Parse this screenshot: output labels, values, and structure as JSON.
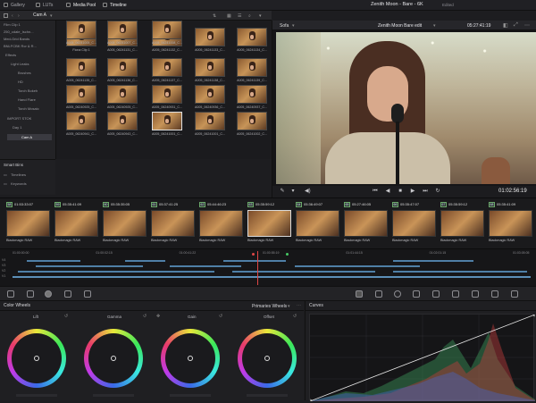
{
  "tabs": [
    {
      "label": "Gallery"
    },
    {
      "label": "LUTs"
    },
    {
      "label": "Media Pool"
    },
    {
      "label": "Timeline"
    }
  ],
  "project": {
    "title": "Zenith Moon - Bare - 6K",
    "status": "Edited"
  },
  "media_toolbar": {
    "bin": "Cam A"
  },
  "viewer": {
    "timeline_name": "Zenith Moon Bare edit",
    "timecode": "05:27:41:19",
    "clip_name": "Sofa",
    "zoom": "65%",
    "playhead_tc": "01:02:56:19"
  },
  "tree": [
    {
      "label": "Film Clip 1"
    },
    {
      "label": "250_cdale_Ischn..."
    },
    {
      "label": "Med-Grid Bands"
    },
    {
      "label": "BNLFCBK Rcr & R..."
    },
    {
      "label": "Effects"
    },
    {
      "label": "Light Leaks"
    },
    {
      "label": "Brushes"
    },
    {
      "label": "HD"
    },
    {
      "label": "Torch Bokeh"
    },
    {
      "label": "Hand Flare"
    },
    {
      "label": "Torch Mosaic"
    },
    {
      "label": "IMPORT STOK"
    },
    {
      "label": "Day 1"
    },
    {
      "label": "Cam A"
    }
  ],
  "smart_bins": {
    "title": "Smart Bins",
    "items": [
      {
        "label": "Timelines"
      },
      {
        "label": "Keywords"
      }
    ]
  },
  "media_clips": [
    {
      "label": "Fiona Clip 1"
    },
    {
      "label": "A005_06241131_C..."
    },
    {
      "label": "A005_06241132_C..."
    },
    {
      "label": "A005_06241133_C..."
    },
    {
      "label": "A005_06241134_C..."
    },
    {
      "label": "A005_06241135_C..."
    },
    {
      "label": "A005_06241136_C..."
    },
    {
      "label": "A005_06241137_C..."
    },
    {
      "label": "A005_06241138_C..."
    },
    {
      "label": "A005_06241139_C..."
    },
    {
      "label": "A005_06240925_C..."
    },
    {
      "label": "A005_06240925_C..."
    },
    {
      "label": "A005_06240931_C..."
    },
    {
      "label": "A005_06240936_C..."
    },
    {
      "label": "A005_06240937_C..."
    },
    {
      "label": "A005_06240941_C..."
    },
    {
      "label": "A005_06240943_C..."
    },
    {
      "label": "A005_06241001_C..."
    },
    {
      "label": "A005_06241001_C..."
    },
    {
      "label": "A005_06241002_C..."
    },
    {
      "label": "A005_06241005_C..."
    },
    {
      "label": "A005_06241007_C..."
    },
    {
      "label": "A005_06241008_C..."
    }
  ],
  "strip_clips": [
    {
      "num": "58",
      "tc": "01:53:33:07",
      "label": "Blackmagic RAW"
    },
    {
      "num": "59",
      "tc": "05:35:41:09",
      "label": "Blackmagic RAW"
    },
    {
      "num": "60",
      "tc": "05:35:35:05",
      "label": "Blackmagic RAW"
    },
    {
      "num": "61",
      "tc": "05:37:41:25",
      "label": "Blackmagic RAW"
    },
    {
      "num": "62",
      "tc": "05:44:46:23",
      "label": "Blackmagic RAW"
    },
    {
      "num": "63",
      "tc": "05:35:59:12",
      "label": "Blackmagic RAW"
    },
    {
      "num": "64",
      "tc": "05:36:49:07",
      "label": "Blackmagic RAW"
    },
    {
      "num": "65",
      "tc": "05:27:46:05",
      "label": "Blackmagic RAW"
    },
    {
      "num": "66",
      "tc": "05:35:47:07",
      "label": "Blackmagic RAW"
    },
    {
      "num": "67",
      "tc": "05:35:59:12",
      "label": "Blackmagic RAW"
    },
    {
      "num": "68",
      "tc": "05:35:41:09",
      "label": "Blackmagic RAW"
    }
  ],
  "timeline_ruler": [
    "01:00:00:00",
    "01:00:02:15",
    "01:00:41:22",
    "01:00:55:19",
    "01:01:44:15",
    "01:02:01:15",
    "01:03:05:05"
  ],
  "color_wheels": {
    "title": "Color Wheels",
    "mode": "Primaries Wheels",
    "wheels": [
      {
        "label": "Lift"
      },
      {
        "label": "Gamma"
      },
      {
        "label": "Gain"
      },
      {
        "label": "Offset"
      }
    ]
  },
  "curves": {
    "title": "Curves"
  }
}
